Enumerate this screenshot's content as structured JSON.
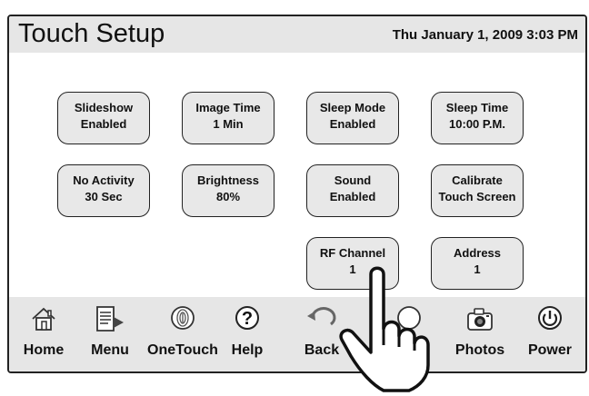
{
  "header": {
    "title": "Touch Setup",
    "datetime": "Thu January 1, 2009  3:03 PM"
  },
  "tiles": [
    {
      "line1": "Slideshow",
      "line2": "Enabled"
    },
    {
      "line1": "Image Time",
      "line2": "1 Min"
    },
    {
      "line1": "Sleep Mode",
      "line2": "Enabled"
    },
    {
      "line1": "Sleep Time",
      "line2": "10:00 P.M."
    },
    {
      "line1": "No Activity",
      "line2": "30 Sec"
    },
    {
      "line1": "Brightness",
      "line2": "80%"
    },
    {
      "line1": "Sound",
      "line2": "Enabled"
    },
    {
      "line1": "Calibrate",
      "line2": "Touch Screen"
    },
    {
      "line1": "RF Channel",
      "line2": "1"
    },
    {
      "line1": "Address",
      "line2": "1"
    }
  ],
  "nav": [
    {
      "label": "Home",
      "icon": "home-icon"
    },
    {
      "label": "Menu",
      "icon": "menu-icon"
    },
    {
      "label": "OneTouch",
      "icon": "onetouch-icon"
    },
    {
      "label": "Help",
      "icon": "help-icon"
    },
    {
      "label": "Back",
      "icon": "back-icon"
    },
    {
      "label": "",
      "icon": "hidden-icon"
    },
    {
      "label": "Photos",
      "icon": "camera-icon"
    },
    {
      "label": "Power",
      "icon": "power-icon"
    }
  ],
  "overlay": {
    "icon": "pointing-hand-icon"
  }
}
